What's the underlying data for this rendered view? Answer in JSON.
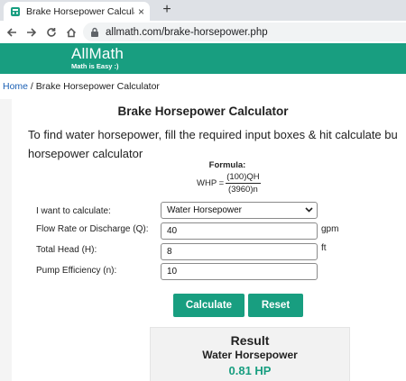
{
  "browser": {
    "tab_title": "Brake Horsepower Calculator – C",
    "tab_close": "×",
    "new_tab": "+",
    "url": "allmath.com/brake-horsepower.php"
  },
  "site": {
    "logo_title": "AllMath",
    "logo_tagline": "Math is Easy :)",
    "header_color": "#189e80"
  },
  "breadcrumb": {
    "home": "Home",
    "separator": " / ",
    "current": "Brake Horsepower Calculator"
  },
  "calculator": {
    "title": "Brake Horsepower Calculator",
    "intro_line1": "To find water horsepower, fill the required input boxes & hit calculate bu",
    "intro_line2": "horsepower calculator",
    "formula_label": "Formula:",
    "formula_lhs": "WHP =",
    "formula_numerator": "(100)QH",
    "formula_denominator": "(3960)n",
    "fields": {
      "calculate": {
        "label": "I want to calculate:",
        "value": "Water Horsepower"
      },
      "flow_rate": {
        "label": "Flow Rate or Discharge (Q):",
        "value": "40",
        "unit": "gpm"
      },
      "total_head": {
        "label": "Total Head (H):",
        "value": "8",
        "unit": "ft"
      },
      "pump_efficiency": {
        "label": "Pump Efficiency (n):",
        "value": "10"
      }
    },
    "buttons": {
      "calculate": "Calculate",
      "reset": "Reset"
    }
  },
  "result": {
    "title": "Result",
    "subtitle": "Water Horsepower",
    "value": "0.81 HP"
  }
}
